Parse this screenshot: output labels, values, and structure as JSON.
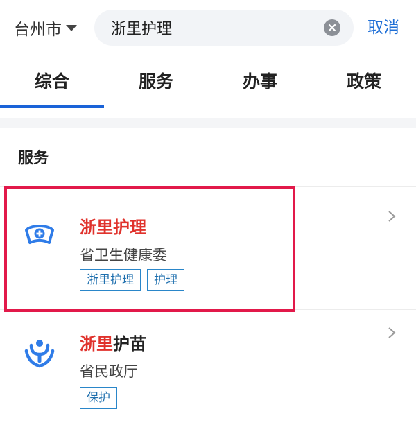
{
  "header": {
    "city": "台州市",
    "search_value": "浙里护理",
    "cancel_label": "取消"
  },
  "tabs": [
    {
      "label": "综合",
      "active": true
    },
    {
      "label": "服务",
      "active": false
    },
    {
      "label": "办事",
      "active": false
    },
    {
      "label": "政策",
      "active": false
    }
  ],
  "section": {
    "title": "服务"
  },
  "results": [
    {
      "title_highlight": "浙里护理",
      "title_rest": "",
      "department": "省卫生健康委",
      "tags": [
        "浙里护理",
        "护理"
      ],
      "icon": "nurse-cap-icon"
    },
    {
      "title_highlight": "浙里",
      "title_rest": "护苗",
      "department": "省民政厅",
      "tags": [
        "保护"
      ],
      "icon": "child-protection-icon"
    }
  ],
  "colors": {
    "accent": "#1a63d8",
    "highlight_text": "#e0322c",
    "selection_box": "#e2194a",
    "tag_border": "#2a86c9"
  }
}
